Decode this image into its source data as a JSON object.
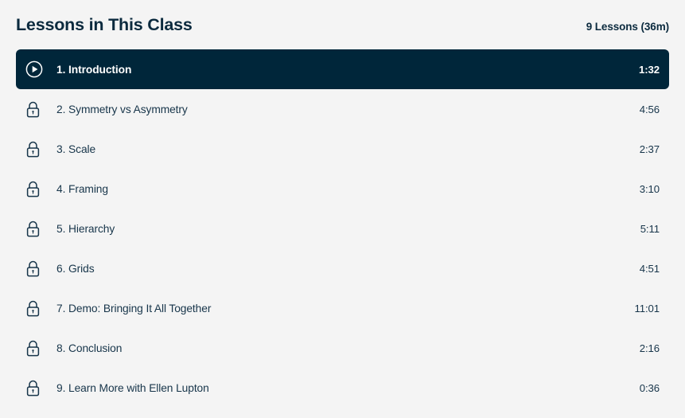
{
  "header": {
    "title": "Lessons in This Class",
    "lesson_count": "9 Lessons (36m)"
  },
  "colors": {
    "page_background": "#f4f4f4",
    "active_row_background": "#00263a",
    "text_primary": "#17354a",
    "text_on_active": "#ffffff"
  },
  "lessons": [
    {
      "title": "1. Introduction",
      "duration": "1:32",
      "state": "active",
      "icon": "play-circle-icon"
    },
    {
      "title": "2. Symmetry vs Asymmetry",
      "duration": "4:56",
      "state": "locked",
      "icon": "lock-icon"
    },
    {
      "title": "3. Scale",
      "duration": "2:37",
      "state": "locked",
      "icon": "lock-icon"
    },
    {
      "title": "4. Framing",
      "duration": "3:10",
      "state": "locked",
      "icon": "lock-icon"
    },
    {
      "title": "5. Hierarchy",
      "duration": "5:11",
      "state": "locked",
      "icon": "lock-icon"
    },
    {
      "title": "6. Grids",
      "duration": "4:51",
      "state": "locked",
      "icon": "lock-icon"
    },
    {
      "title": "7. Demo: Bringing It All Together",
      "duration": "11:01",
      "state": "locked",
      "icon": "lock-icon"
    },
    {
      "title": "8. Conclusion",
      "duration": "2:16",
      "state": "locked",
      "icon": "lock-icon"
    },
    {
      "title": "9. Learn More with Ellen Lupton",
      "duration": "0:36",
      "state": "locked",
      "icon": "lock-icon"
    }
  ]
}
